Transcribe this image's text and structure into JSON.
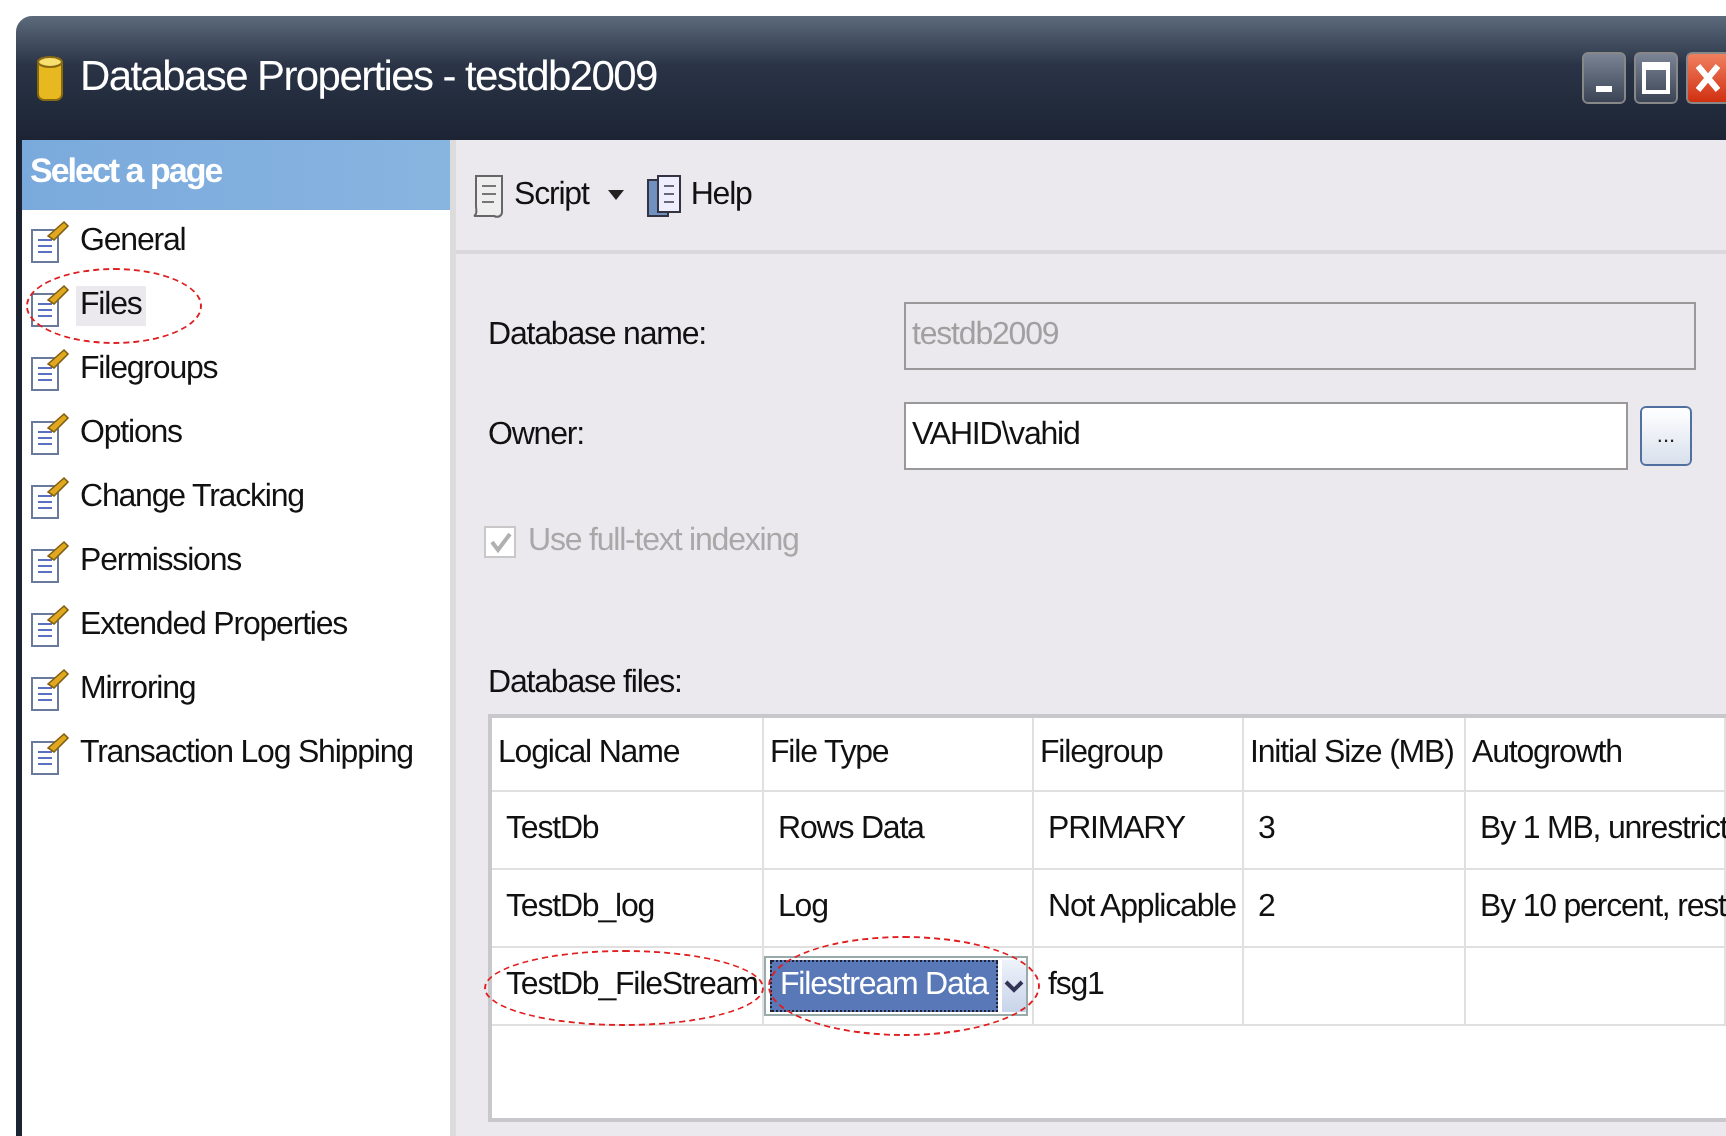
{
  "window": {
    "title": "Database Properties - testdb2009"
  },
  "sidebar": {
    "header": "Select a page",
    "items": [
      {
        "label": "General",
        "selected": false,
        "circled": false
      },
      {
        "label": "Files",
        "selected": true,
        "circled": true
      },
      {
        "label": "Filegroups",
        "selected": false,
        "circled": false
      },
      {
        "label": "Options",
        "selected": false,
        "circled": false
      },
      {
        "label": "Change Tracking",
        "selected": false,
        "circled": false
      },
      {
        "label": "Permissions",
        "selected": false,
        "circled": false
      },
      {
        "label": "Extended Properties",
        "selected": false,
        "circled": false
      },
      {
        "label": "Mirroring",
        "selected": false,
        "circled": false
      },
      {
        "label": "Transaction Log Shipping",
        "selected": false,
        "circled": false
      }
    ]
  },
  "toolbar": {
    "script": "Script",
    "help": "Help"
  },
  "form": {
    "database_name": {
      "label": "Database name:",
      "value": "testdb2009",
      "disabled": true
    },
    "owner": {
      "label": "Owner:",
      "value": "VAHID\\vahid",
      "browse": "..."
    },
    "full_text_indexing": {
      "label": "Use full-text indexing",
      "checked": true,
      "disabled": true
    },
    "files_label": "Database files:"
  },
  "table": {
    "columns": [
      "Logical Name",
      "File Type",
      "Filegroup",
      "Initial Size (MB)",
      "Autogrowth"
    ],
    "rows": [
      {
        "cells": [
          "TestDb",
          "Rows Data",
          "PRIMARY",
          "3",
          "By 1 MB, unrestrict"
        ],
        "editing": false,
        "circled": false
      },
      {
        "cells": [
          "TestDb_log",
          "Log",
          "Not Applicable",
          "2",
          "By 10 percent, rest"
        ],
        "editing": false,
        "circled": false
      },
      {
        "cells": [
          "TestDb_FileStream",
          "Filestream Data",
          "fsg1",
          "",
          ""
        ],
        "editing": true,
        "circled": true
      }
    ]
  }
}
